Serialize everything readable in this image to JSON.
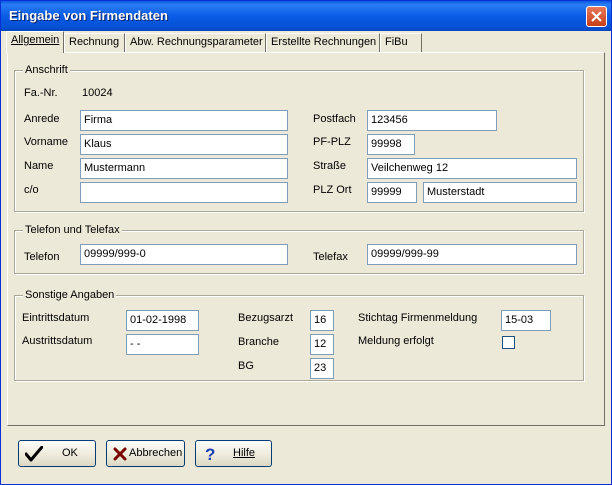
{
  "window": {
    "title": "Eingabe von Firmendaten"
  },
  "tabs": [
    {
      "label": "Allgemein",
      "active": true
    },
    {
      "label": "Rechnung",
      "active": false
    },
    {
      "label": "Abw. Rechnungsparameter",
      "active": false
    },
    {
      "label": "Erstellte Rechnungen",
      "active": false
    },
    {
      "label": "FiBu",
      "active": false
    }
  ],
  "anschrift": {
    "title": "Anschrift",
    "fa_nr_label": "Fa.-Nr.",
    "fa_nr_value": "10024",
    "anrede_label": "Anrede",
    "anrede_value": "Firma",
    "vorname_label": "Vorname",
    "vorname_value": "Klaus",
    "name_label": "Name",
    "name_value": "Mustermann",
    "co_label": "c/o",
    "co_value": "",
    "postfach_label": "Postfach",
    "postfach_value": "123456",
    "pfplz_label": "PF-PLZ",
    "pfplz_value": "99998",
    "strasse_label": "Straße",
    "strasse_value": "Veilchenweg 12",
    "plzort_label": "PLZ Ort",
    "plz_value": "99999",
    "ort_value": "Musterstadt"
  },
  "telefon": {
    "title": "Telefon und Telefax",
    "telefon_label": "Telefon",
    "telefon_value": "09999/999-0",
    "telefax_label": "Telefax",
    "telefax_value": "09999/999-99"
  },
  "sonstige": {
    "title": "Sonstige Angaben",
    "eintritt_label": "Eintrittsdatum",
    "eintritt_value": "01-02-1998",
    "austritt_label": "Austrittsdatum",
    "austritt_value": " - -",
    "bezugsarzt_label": "Bezugsarzt",
    "bezugsarzt_value": "16",
    "branche_label": "Branche",
    "branche_value": "12",
    "bg_label": "BG",
    "bg_value": "23",
    "stichtag_label": "Stichtag Firmenmeldung",
    "stichtag_value": "15-03",
    "meldung_label": "Meldung erfolgt",
    "meldung_checked": false
  },
  "buttons": {
    "ok_label": "OK",
    "abbrechen_label": "Abbrechen",
    "hilfe_label": "Hilfe"
  },
  "icons": {
    "ok": "checkmark-icon",
    "abbrechen": "x-cancel-icon",
    "hilfe": "question-icon",
    "close": "close-icon"
  }
}
